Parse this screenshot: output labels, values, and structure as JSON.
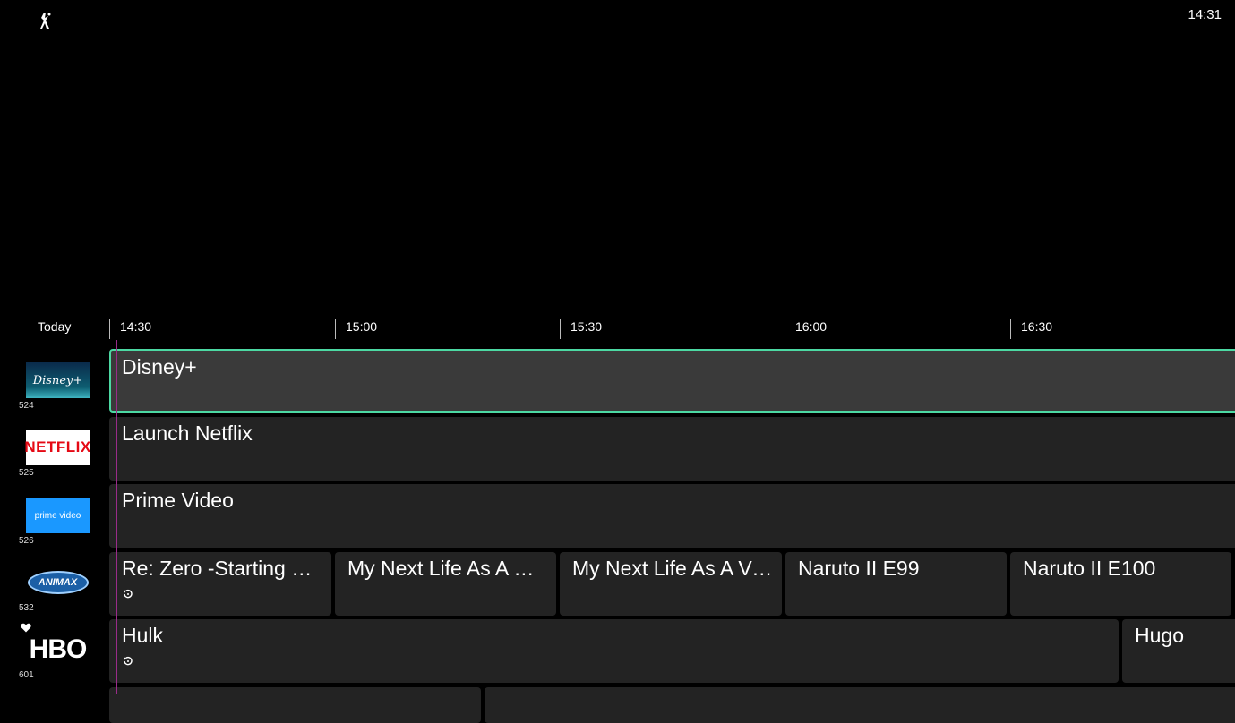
{
  "header": {
    "clock": "14:31",
    "logo_icon": "app-logo-icon"
  },
  "timeline": {
    "day": "Today",
    "times": [
      "14:30",
      "15:00",
      "15:30",
      "16:00",
      "16:30"
    ]
  },
  "channels": [
    {
      "logo": "Disney+",
      "number": "524"
    },
    {
      "logo": "NETFLIX",
      "number": "525"
    },
    {
      "logo": "prime video",
      "number": "526"
    },
    {
      "logo": "ANIMAX",
      "number": "532"
    },
    {
      "logo": "HBO",
      "number": "601",
      "favorite": true
    }
  ],
  "programs": {
    "disney": "Disney+",
    "netflix": "Launch Netflix",
    "prime": "Prime Video",
    "animax": [
      "Re: Zero -Starting Li…",
      "My Next Life As A Vi…",
      "My Next Life As A Vi…",
      "Naruto II E99",
      "Naruto II E100"
    ],
    "hbo": [
      "Hulk",
      "Hugo"
    ]
  },
  "colors": {
    "focus": "#4cd9a3",
    "now_line": "#9a2c8a",
    "cell": "#232323",
    "cell_focused": "#3a3a3a"
  }
}
